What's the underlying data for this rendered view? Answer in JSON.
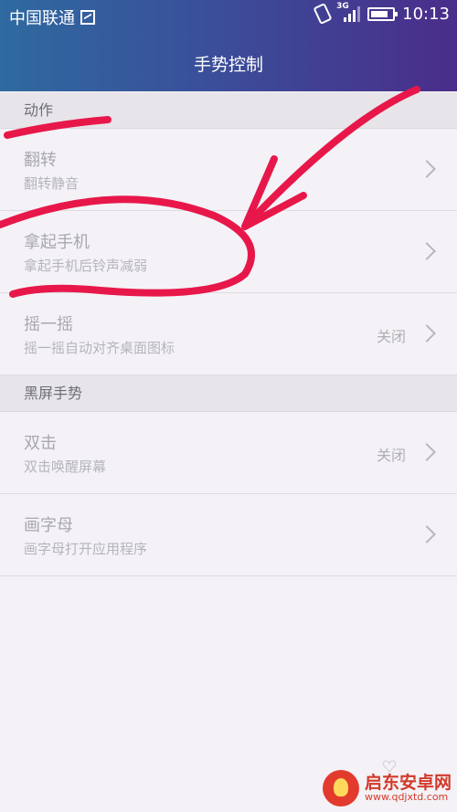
{
  "status_bar": {
    "carrier": "中国联通",
    "network": "3G",
    "time": "10:13"
  },
  "header": {
    "title": "手势控制"
  },
  "sections": [
    {
      "header": "动作",
      "items": [
        {
          "title": "翻转",
          "subtitle": "翻转静音",
          "value": ""
        },
        {
          "title": "拿起手机",
          "subtitle": "拿起手机后铃声减弱",
          "value": ""
        },
        {
          "title": "摇一摇",
          "subtitle": "摇一摇自动对齐桌面图标",
          "value": "关闭"
        }
      ]
    },
    {
      "header": "黑屏手势",
      "items": [
        {
          "title": "双击",
          "subtitle": "双击唤醒屏幕",
          "value": "关闭"
        },
        {
          "title": "画字母",
          "subtitle": "画字母打开应用程序",
          "value": ""
        }
      ]
    }
  ],
  "watermark": {
    "name": "启东安卓网",
    "url": "www.qdjxtd.com"
  },
  "colors": {
    "header_start": "#2f6aa0",
    "header_end": "#4a2d8a",
    "annotation": "#e8174a",
    "background": "#f4f2f6"
  }
}
